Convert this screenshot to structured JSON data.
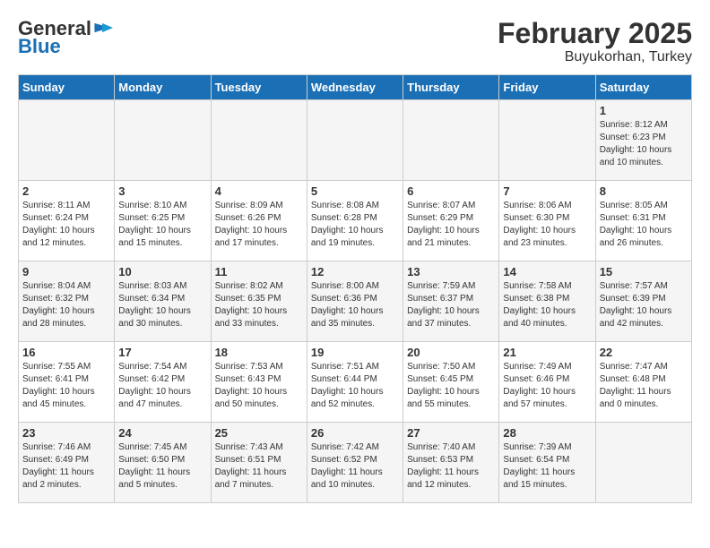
{
  "header": {
    "logo_line1": "General",
    "logo_line2": "Blue",
    "title": "February 2025",
    "subtitle": "Buyukorhan, Turkey"
  },
  "weekdays": [
    "Sunday",
    "Monday",
    "Tuesday",
    "Wednesday",
    "Thursday",
    "Friday",
    "Saturday"
  ],
  "weeks": [
    [
      {
        "day": "",
        "info": ""
      },
      {
        "day": "",
        "info": ""
      },
      {
        "day": "",
        "info": ""
      },
      {
        "day": "",
        "info": ""
      },
      {
        "day": "",
        "info": ""
      },
      {
        "day": "",
        "info": ""
      },
      {
        "day": "1",
        "info": "Sunrise: 8:12 AM\nSunset: 6:23 PM\nDaylight: 10 hours\nand 10 minutes."
      }
    ],
    [
      {
        "day": "2",
        "info": "Sunrise: 8:11 AM\nSunset: 6:24 PM\nDaylight: 10 hours\nand 12 minutes."
      },
      {
        "day": "3",
        "info": "Sunrise: 8:10 AM\nSunset: 6:25 PM\nDaylight: 10 hours\nand 15 minutes."
      },
      {
        "day": "4",
        "info": "Sunrise: 8:09 AM\nSunset: 6:26 PM\nDaylight: 10 hours\nand 17 minutes."
      },
      {
        "day": "5",
        "info": "Sunrise: 8:08 AM\nSunset: 6:28 PM\nDaylight: 10 hours\nand 19 minutes."
      },
      {
        "day": "6",
        "info": "Sunrise: 8:07 AM\nSunset: 6:29 PM\nDaylight: 10 hours\nand 21 minutes."
      },
      {
        "day": "7",
        "info": "Sunrise: 8:06 AM\nSunset: 6:30 PM\nDaylight: 10 hours\nand 23 minutes."
      },
      {
        "day": "8",
        "info": "Sunrise: 8:05 AM\nSunset: 6:31 PM\nDaylight: 10 hours\nand 26 minutes."
      }
    ],
    [
      {
        "day": "9",
        "info": "Sunrise: 8:04 AM\nSunset: 6:32 PM\nDaylight: 10 hours\nand 28 minutes."
      },
      {
        "day": "10",
        "info": "Sunrise: 8:03 AM\nSunset: 6:34 PM\nDaylight: 10 hours\nand 30 minutes."
      },
      {
        "day": "11",
        "info": "Sunrise: 8:02 AM\nSunset: 6:35 PM\nDaylight: 10 hours\nand 33 minutes."
      },
      {
        "day": "12",
        "info": "Sunrise: 8:00 AM\nSunset: 6:36 PM\nDaylight: 10 hours\nand 35 minutes."
      },
      {
        "day": "13",
        "info": "Sunrise: 7:59 AM\nSunset: 6:37 PM\nDaylight: 10 hours\nand 37 minutes."
      },
      {
        "day": "14",
        "info": "Sunrise: 7:58 AM\nSunset: 6:38 PM\nDaylight: 10 hours\nand 40 minutes."
      },
      {
        "day": "15",
        "info": "Sunrise: 7:57 AM\nSunset: 6:39 PM\nDaylight: 10 hours\nand 42 minutes."
      }
    ],
    [
      {
        "day": "16",
        "info": "Sunrise: 7:55 AM\nSunset: 6:41 PM\nDaylight: 10 hours\nand 45 minutes."
      },
      {
        "day": "17",
        "info": "Sunrise: 7:54 AM\nSunset: 6:42 PM\nDaylight: 10 hours\nand 47 minutes."
      },
      {
        "day": "18",
        "info": "Sunrise: 7:53 AM\nSunset: 6:43 PM\nDaylight: 10 hours\nand 50 minutes."
      },
      {
        "day": "19",
        "info": "Sunrise: 7:51 AM\nSunset: 6:44 PM\nDaylight: 10 hours\nand 52 minutes."
      },
      {
        "day": "20",
        "info": "Sunrise: 7:50 AM\nSunset: 6:45 PM\nDaylight: 10 hours\nand 55 minutes."
      },
      {
        "day": "21",
        "info": "Sunrise: 7:49 AM\nSunset: 6:46 PM\nDaylight: 10 hours\nand 57 minutes."
      },
      {
        "day": "22",
        "info": "Sunrise: 7:47 AM\nSunset: 6:48 PM\nDaylight: 11 hours\nand 0 minutes."
      }
    ],
    [
      {
        "day": "23",
        "info": "Sunrise: 7:46 AM\nSunset: 6:49 PM\nDaylight: 11 hours\nand 2 minutes."
      },
      {
        "day": "24",
        "info": "Sunrise: 7:45 AM\nSunset: 6:50 PM\nDaylight: 11 hours\nand 5 minutes."
      },
      {
        "day": "25",
        "info": "Sunrise: 7:43 AM\nSunset: 6:51 PM\nDaylight: 11 hours\nand 7 minutes."
      },
      {
        "day": "26",
        "info": "Sunrise: 7:42 AM\nSunset: 6:52 PM\nDaylight: 11 hours\nand 10 minutes."
      },
      {
        "day": "27",
        "info": "Sunrise: 7:40 AM\nSunset: 6:53 PM\nDaylight: 11 hours\nand 12 minutes."
      },
      {
        "day": "28",
        "info": "Sunrise: 7:39 AM\nSunset: 6:54 PM\nDaylight: 11 hours\nand 15 minutes."
      },
      {
        "day": "",
        "info": ""
      }
    ]
  ]
}
